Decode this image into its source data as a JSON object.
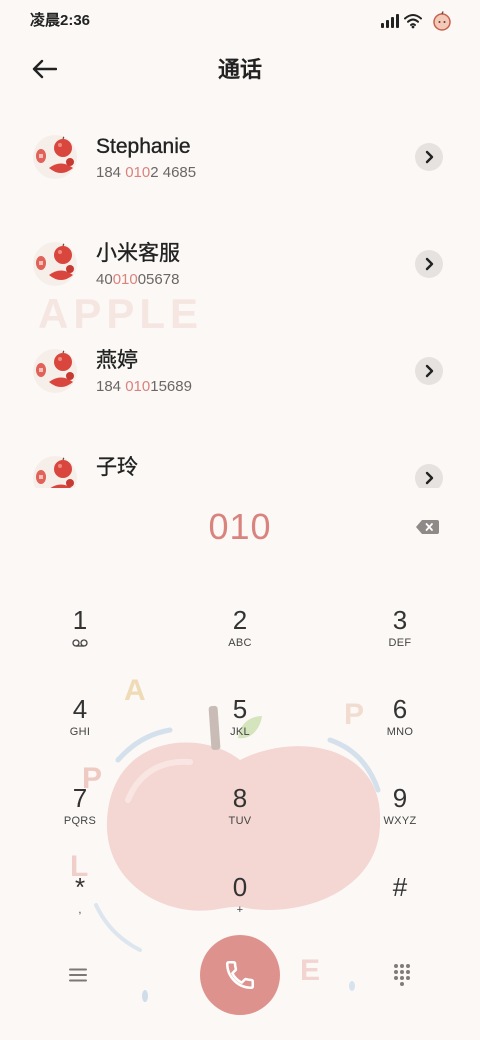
{
  "status_bar": {
    "time": "凌晨2:36",
    "icons": [
      "signal-icon",
      "wifi-icon",
      "apple-icon"
    ]
  },
  "header": {
    "title": "通话",
    "back_icon": "back-arrow-icon"
  },
  "contacts": [
    {
      "name": "Stephanie",
      "number_prefix": "184 ",
      "number_match": "010",
      "number_suffix": "2 4685",
      "action_icon": "chevron-right-icon"
    },
    {
      "name": "小米客服",
      "number_prefix": "40",
      "number_match": "010",
      "number_suffix": "05678",
      "action_icon": "chevron-right-icon"
    },
    {
      "name": "燕婷",
      "number_prefix": "184 ",
      "number_match": "010",
      "number_suffix": "15689",
      "action_icon": "chevron-right-icon"
    },
    {
      "name": "子玲",
      "action_icon": "chevron-right-icon"
    }
  ],
  "dialer": {
    "input": "010",
    "delete_icon": "backspace-icon"
  },
  "keypad": [
    {
      "digit": "1",
      "sub_icon": "voicemail-icon"
    },
    {
      "digit": "2",
      "sub": "ABC"
    },
    {
      "digit": "3",
      "sub": "DEF"
    },
    {
      "digit": "4",
      "sub": "GHI"
    },
    {
      "digit": "5",
      "sub": "JKL"
    },
    {
      "digit": "6",
      "sub": "MNO"
    },
    {
      "digit": "7",
      "sub": "PQRS"
    },
    {
      "digit": "8",
      "sub": "TUV"
    },
    {
      "digit": "9",
      "sub": "WXYZ"
    },
    {
      "digit": "*",
      "sub": ","
    },
    {
      "digit": "0",
      "sub": "+"
    },
    {
      "digit": "#"
    }
  ],
  "bottom_bar": {
    "left_icon": "menu-icon",
    "center_icon": "phone-icon",
    "right_icon": "dialpad-icon"
  },
  "wallpaper": {
    "watermark": "APPLE",
    "letters": [
      "A",
      "P",
      "P",
      "L",
      "E"
    ]
  },
  "colors": {
    "background": "#fbf8f5",
    "accent": "#d9837e",
    "call_button": "#de928d",
    "text": "#222222",
    "secondary_text": "#6b6766",
    "chevron_button": "#e6e2df"
  }
}
